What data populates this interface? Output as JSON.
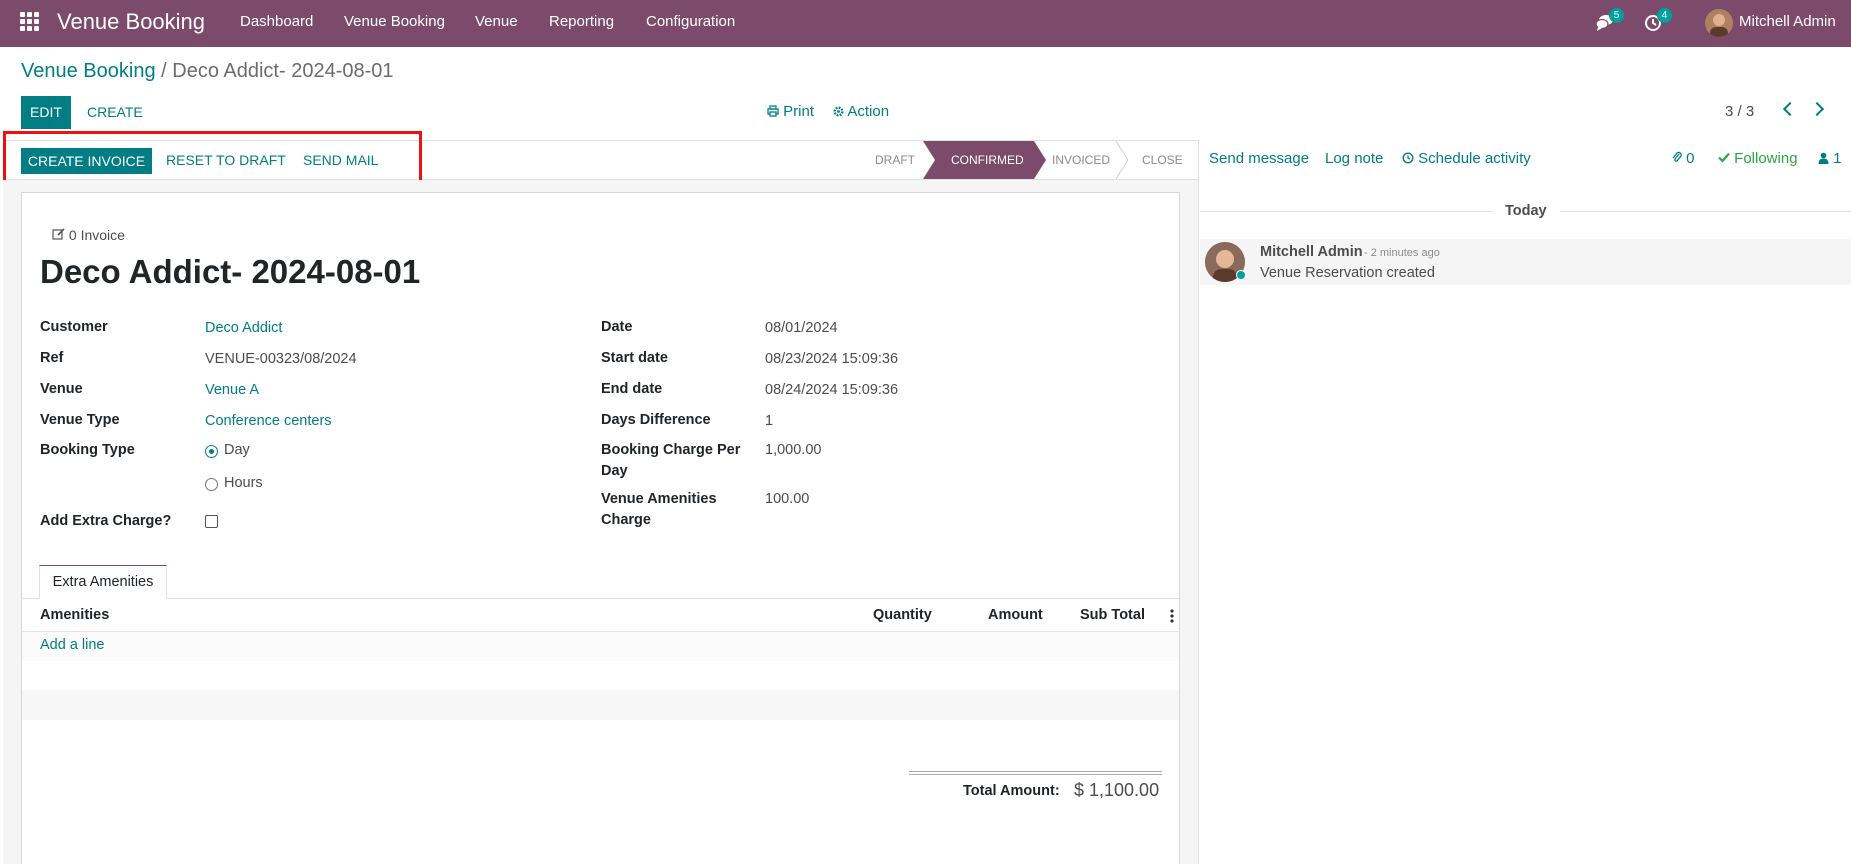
{
  "navbar": {
    "brand": "Venue Booking",
    "menu": [
      "Dashboard",
      "Venue Booking",
      "Venue",
      "Reporting",
      "Configuration"
    ],
    "messages_count": "5",
    "activities_count": "4",
    "user": "Mitchell Admin"
  },
  "breadcrumb": {
    "parent": "Venue Booking",
    "separator": "/",
    "current": "Deco Addict- 2024-08-01"
  },
  "toolbar": {
    "edit": "EDIT",
    "create": "CREATE",
    "print": "Print",
    "action": "Action",
    "pager": "3 / 3"
  },
  "header_buttons": {
    "create_invoice": "CREATE INVOICE",
    "reset_to_draft": "RESET TO DRAFT",
    "send_mail": "SEND MAIL"
  },
  "stages": [
    {
      "label": "DRAFT",
      "active": false
    },
    {
      "label": "CONFIRMED",
      "active": true
    },
    {
      "label": "INVOICED",
      "active": false
    },
    {
      "label": "CLOSE",
      "active": false
    }
  ],
  "form": {
    "invoice_button": "0 Invoice",
    "title": "Deco Addict- 2024-08-01",
    "left": {
      "customer_label": "Customer",
      "customer": "Deco Addict",
      "ref_label": "Ref",
      "ref": "VENUE-00323/08/2024",
      "venue_label": "Venue",
      "venue": "Venue A",
      "venue_type_label": "Venue Type",
      "venue_type": "Conference centers",
      "booking_type_label": "Booking Type",
      "booking_type_day": "Day",
      "booking_type_hours": "Hours",
      "extra_charge_label": "Add Extra Charge?"
    },
    "right": {
      "date_label": "Date",
      "date": "08/01/2024",
      "start_label": "Start date",
      "start": "08/23/2024 15:09:36",
      "end_label": "End date",
      "end": "08/24/2024 15:09:36",
      "days_label": "Days Difference",
      "days": "1",
      "charge_label_1": "Booking Charge Per",
      "charge_label_2": "Day",
      "charge": "1,000.00",
      "amen_label_1": "Venue Amenities",
      "amen_label_2": "Charge",
      "amen": "100.00"
    },
    "tab": "Extra Amenities",
    "table_headers": {
      "amenities": "Amenities",
      "quantity": "Quantity",
      "amount": "Amount",
      "subtotal": "Sub Total"
    },
    "add_line": "Add a line",
    "total_label": "Total Amount:",
    "total_value": "$ 1,100.00"
  },
  "chatter": {
    "send_message": "Send message",
    "log_note": "Log note",
    "schedule_activity": "Schedule activity",
    "attachments": "0",
    "following": "Following",
    "followers": "1",
    "today": "Today",
    "author": "Mitchell Admin",
    "time": "- 2 minutes ago",
    "message": "Venue Reservation created"
  },
  "colors": {
    "brand": "#7c4a6b",
    "primary": "#017e84",
    "highlight": "#ee1111",
    "following": "#28a745"
  }
}
